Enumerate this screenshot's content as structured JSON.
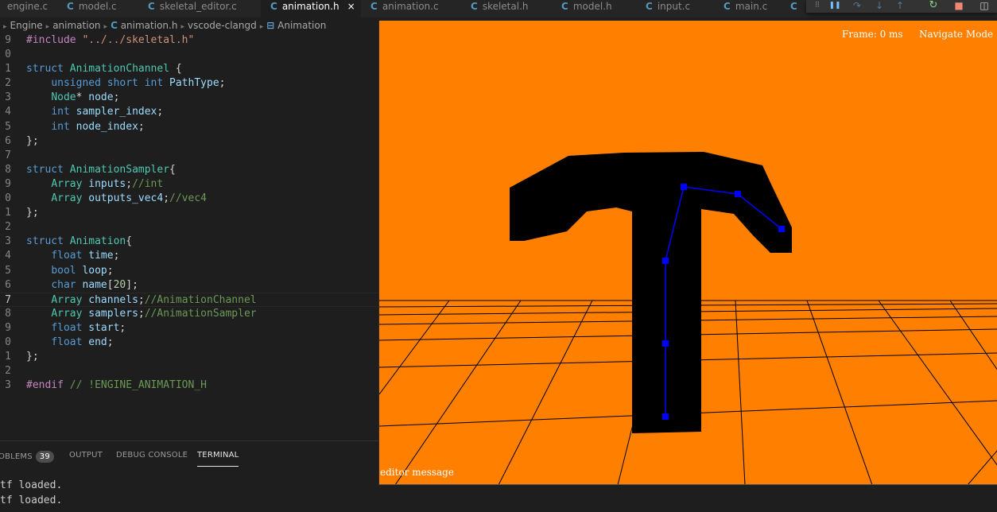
{
  "tabs": [
    {
      "label": "engine.c",
      "icon": "c-file-icon"
    },
    {
      "label": "model.c",
      "icon": "c-file-icon"
    },
    {
      "label": "skeletal_editor.c",
      "icon": "c-file-icon"
    },
    {
      "label": "animation.h",
      "icon": "c-file-icon",
      "active": true
    },
    {
      "label": "animation.c",
      "icon": "c-file-icon"
    },
    {
      "label": "skeletal.h",
      "icon": "c-file-icon"
    },
    {
      "label": "model.h",
      "icon": "c-file-icon"
    },
    {
      "label": "input.c",
      "icon": "c-file-icon"
    },
    {
      "label": "main.c",
      "icon": "c-file-icon"
    }
  ],
  "c_glyph": "C",
  "close_glyph": "×",
  "debug_toolbar": {
    "buttons": [
      "drag-handle-icon",
      "pause-icon",
      "step-over-icon",
      "step-into-icon",
      "step-out-icon",
      "restart-icon",
      "stop-icon"
    ],
    "glyphs": {
      "grip": "⠿",
      "pause": "❚❚",
      "over": "↷",
      "into": "↓",
      "out": "↑",
      "restart": "↻",
      "stop": "■",
      "layout": "◫"
    }
  },
  "breadcrumb": {
    "items": [
      "Engine",
      "animation",
      "animation.h",
      "vscode-clangd",
      "Animation"
    ],
    "sep": "▸",
    "struct_icon": "⊟"
  },
  "code": {
    "line_numbers": [
      "9",
      "0",
      "1",
      "2",
      "3",
      "4",
      "5",
      "6",
      "7",
      "8",
      "9",
      "0",
      "1",
      "2",
      "3",
      "4",
      "5",
      "6",
      "7",
      "8",
      "9",
      "0",
      "1",
      "2",
      "3"
    ],
    "current_line_index": 18
  },
  "panel": {
    "problems_label": "OBLEMS",
    "problems_count": "39",
    "output_label": "OUTPUT",
    "debug_console_label": "DEBUG CONSOLE",
    "terminal_label": "TERMINAL",
    "terminal_lines": [
      "tf loaded.",
      "tf loaded."
    ]
  },
  "viewport": {
    "frame_label": "Frame:",
    "frame_value": "0 ms",
    "mode": "Navigate Mode",
    "editor_message": "editor message",
    "colors": {
      "background": "#ff8000",
      "model": "#000000",
      "bones": "#0000ff",
      "grid": "#000000"
    }
  }
}
